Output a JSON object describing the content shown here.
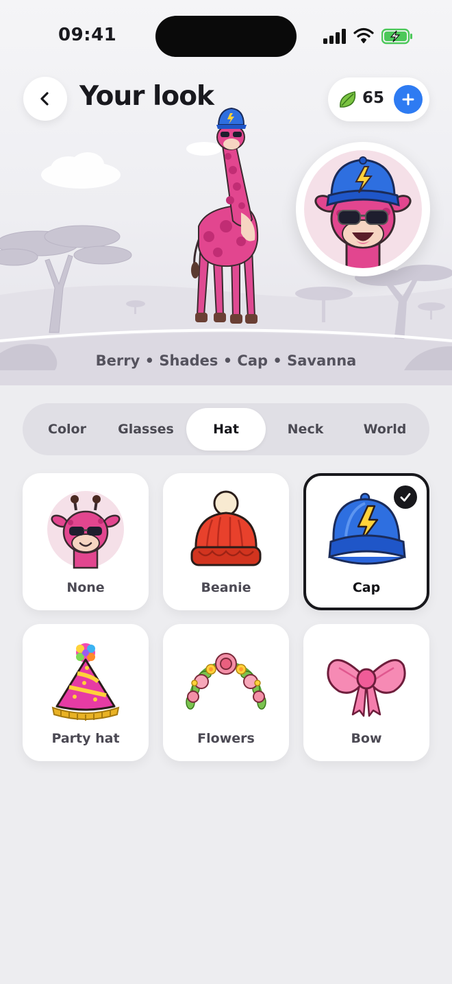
{
  "status_bar": {
    "time": "09:41"
  },
  "header": {
    "title": "Your look",
    "coin_count": "65"
  },
  "summary": "Berry • Shades • Cap • Savanna",
  "tabs": [
    {
      "label": "Color",
      "active": false
    },
    {
      "label": "Glasses",
      "active": false
    },
    {
      "label": "Hat",
      "active": true
    },
    {
      "label": "Neck",
      "active": false
    },
    {
      "label": "World",
      "active": false
    }
  ],
  "hat_options": [
    {
      "label": "None",
      "icon": "giraffe-face-icon",
      "selected": false
    },
    {
      "label": "Beanie",
      "icon": "beanie-icon",
      "selected": false
    },
    {
      "label": "Cap",
      "icon": "cap-icon",
      "selected": true
    },
    {
      "label": "Party hat",
      "icon": "party-hat-icon",
      "selected": false
    },
    {
      "label": "Flowers",
      "icon": "flower-crown-icon",
      "selected": false
    },
    {
      "label": "Bow",
      "icon": "bow-icon",
      "selected": false
    }
  ],
  "colors": {
    "accent_blue": "#2e7bf2",
    "giraffe_pink": "#e2468f",
    "selected_border": "#18181c"
  }
}
